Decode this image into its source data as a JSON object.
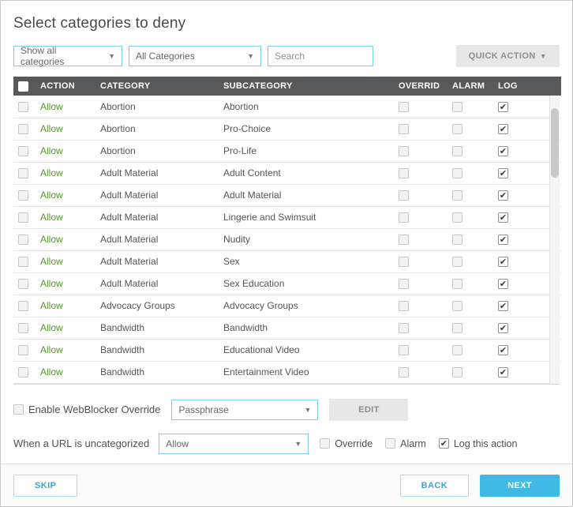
{
  "page": {
    "title": "Select categories to deny"
  },
  "filters": {
    "view_select": "Show all categories",
    "category_select": "All Categories",
    "search_placeholder": "Search",
    "quick_action": "QUICK ACTION"
  },
  "table": {
    "headers": {
      "action": "ACTION",
      "category": "CATEGORY",
      "subcategory": "SUBCATEGORY",
      "override": "OVERRID",
      "alarm": "ALARM",
      "log": "LOG"
    },
    "rows": [
      {
        "selected": false,
        "action": "Allow",
        "category": "Abortion",
        "subcategory": "Abortion",
        "override": false,
        "alarm": false,
        "log": true
      },
      {
        "selected": false,
        "action": "Allow",
        "category": "Abortion",
        "subcategory": "Pro-Choice",
        "override": false,
        "alarm": false,
        "log": true
      },
      {
        "selected": false,
        "action": "Allow",
        "category": "Abortion",
        "subcategory": "Pro-Life",
        "override": false,
        "alarm": false,
        "log": true
      },
      {
        "selected": false,
        "action": "Allow",
        "category": "Adult Material",
        "subcategory": "Adult Content",
        "override": false,
        "alarm": false,
        "log": true
      },
      {
        "selected": false,
        "action": "Allow",
        "category": "Adult Material",
        "subcategory": "Adult Material",
        "override": false,
        "alarm": false,
        "log": true
      },
      {
        "selected": false,
        "action": "Allow",
        "category": "Adult Material",
        "subcategory": "Lingerie and Swimsuit",
        "override": false,
        "alarm": false,
        "log": true
      },
      {
        "selected": false,
        "action": "Allow",
        "category": "Adult Material",
        "subcategory": "Nudity",
        "override": false,
        "alarm": false,
        "log": true
      },
      {
        "selected": false,
        "action": "Allow",
        "category": "Adult Material",
        "subcategory": "Sex",
        "override": false,
        "alarm": false,
        "log": true
      },
      {
        "selected": false,
        "action": "Allow",
        "category": "Adult Material",
        "subcategory": "Sex Education",
        "override": false,
        "alarm": false,
        "log": true
      },
      {
        "selected": false,
        "action": "Allow",
        "category": "Advocacy Groups",
        "subcategory": "Advocacy Groups",
        "override": false,
        "alarm": false,
        "log": true
      },
      {
        "selected": false,
        "action": "Allow",
        "category": "Bandwidth",
        "subcategory": "Bandwidth",
        "override": false,
        "alarm": false,
        "log": true
      },
      {
        "selected": false,
        "action": "Allow",
        "category": "Bandwidth",
        "subcategory": "Educational Video",
        "override": false,
        "alarm": false,
        "log": true
      },
      {
        "selected": false,
        "action": "Allow",
        "category": "Bandwidth",
        "subcategory": "Entertainment Video",
        "override": false,
        "alarm": false,
        "log": true
      }
    ]
  },
  "webblocker_override": {
    "checkbox_label": "Enable WebBlocker Override",
    "checked": false,
    "select_value": "Passphrase",
    "edit_button": "EDIT"
  },
  "uncategorized": {
    "label": "When a URL is uncategorized",
    "select_value": "Allow",
    "options": [
      {
        "label": "Override",
        "checked": false
      },
      {
        "label": "Alarm",
        "checked": false
      },
      {
        "label": "Log this action",
        "checked": true
      }
    ]
  },
  "footer": {
    "skip": "SKIP",
    "back": "BACK",
    "next": "NEXT"
  }
}
